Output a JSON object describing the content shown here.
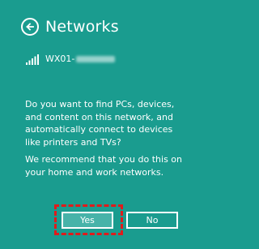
{
  "header": {
    "title": "Networks",
    "back_icon": "back-arrow-circle-icon"
  },
  "network": {
    "ssid_visible": "WX01-",
    "signal_icon": "wifi-signal-icon"
  },
  "dialog": {
    "question": "Do you want to find PCs, devices, and content on this network, and automatically connect to devices like printers and TVs?",
    "recommendation": "We recommend that you do this on your home and work networks."
  },
  "buttons": {
    "yes_label": "Yes",
    "no_label": "No"
  },
  "colors": {
    "background": "#1a9c8f",
    "yes_fill": "#47b3a9",
    "highlight": "#e01b1b"
  }
}
